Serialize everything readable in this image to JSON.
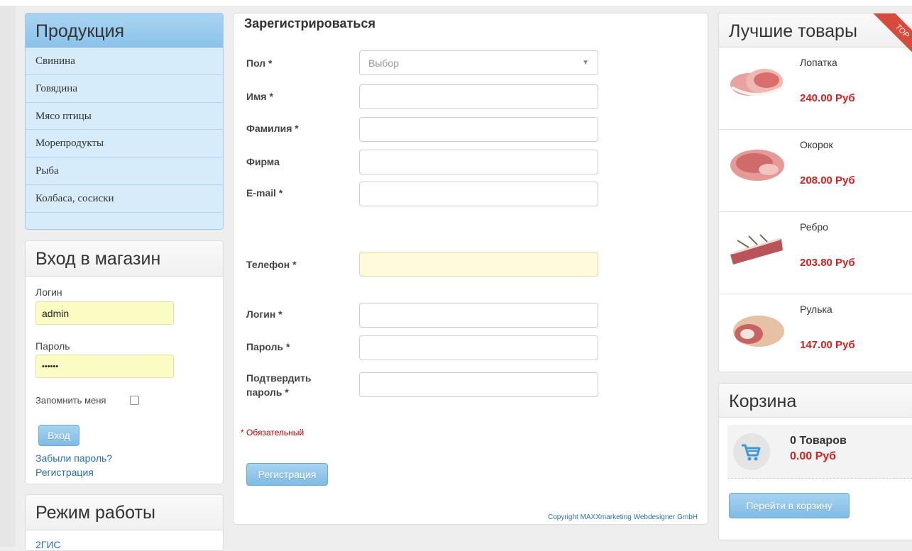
{
  "sidebar": {
    "products_title": "Продукция",
    "categories": [
      "Свинина",
      "Говядина",
      "Мясо птицы",
      "Морепродукты",
      "Рыба",
      "Колбаса, сосиски"
    ]
  },
  "login": {
    "title": "Вход в магазин",
    "login_label": "Логин",
    "login_value": "admin",
    "password_label": "Пароль",
    "password_value": "••••••",
    "remember_label": "Запомнить меня",
    "submit_label": "Вход",
    "forgot_link": "Забыли пароль?",
    "register_link": "Регистрация"
  },
  "hours": {
    "title": "Режим работы",
    "first_line": "2ГИС"
  },
  "registration": {
    "title": "Зарегистрироваться",
    "fields": {
      "gender_label": "Пол *",
      "gender_value": "Выбор",
      "firstname_label": "Имя *",
      "lastname_label": "Фамилия *",
      "company_label": "Фирма",
      "email_label": "E-mail *",
      "phone_label": "Телефон *",
      "login_label": "Логин *",
      "password_label": "Пароль *",
      "confirm_line1": "Подтвердить",
      "confirm_line2": "пароль *"
    },
    "required_note": "* Обязательный",
    "submit_label": "Регистрация",
    "copyright": "Copyright MAXXmarketing Webdesigner GmbH"
  },
  "best": {
    "title": "Лучшие товары",
    "ribbon": "TOP",
    "items": [
      {
        "name": "Лопатка",
        "price": "240.00 Руб"
      },
      {
        "name": "Окорок",
        "price": "208.00 Руб"
      },
      {
        "name": "Ребро",
        "price": "203.80 Руб"
      },
      {
        "name": "Рулька",
        "price": "147.00 Руб"
      }
    ]
  },
  "cart": {
    "title": "Корзина",
    "count": "0 Товаров",
    "total": "0.00 Руб",
    "go_label": "Перейти в корзину"
  },
  "colors": {
    "accent_blue": "#8bc3ea",
    "price_red": "#d12222",
    "input_yellow": "#fbfbc4"
  }
}
